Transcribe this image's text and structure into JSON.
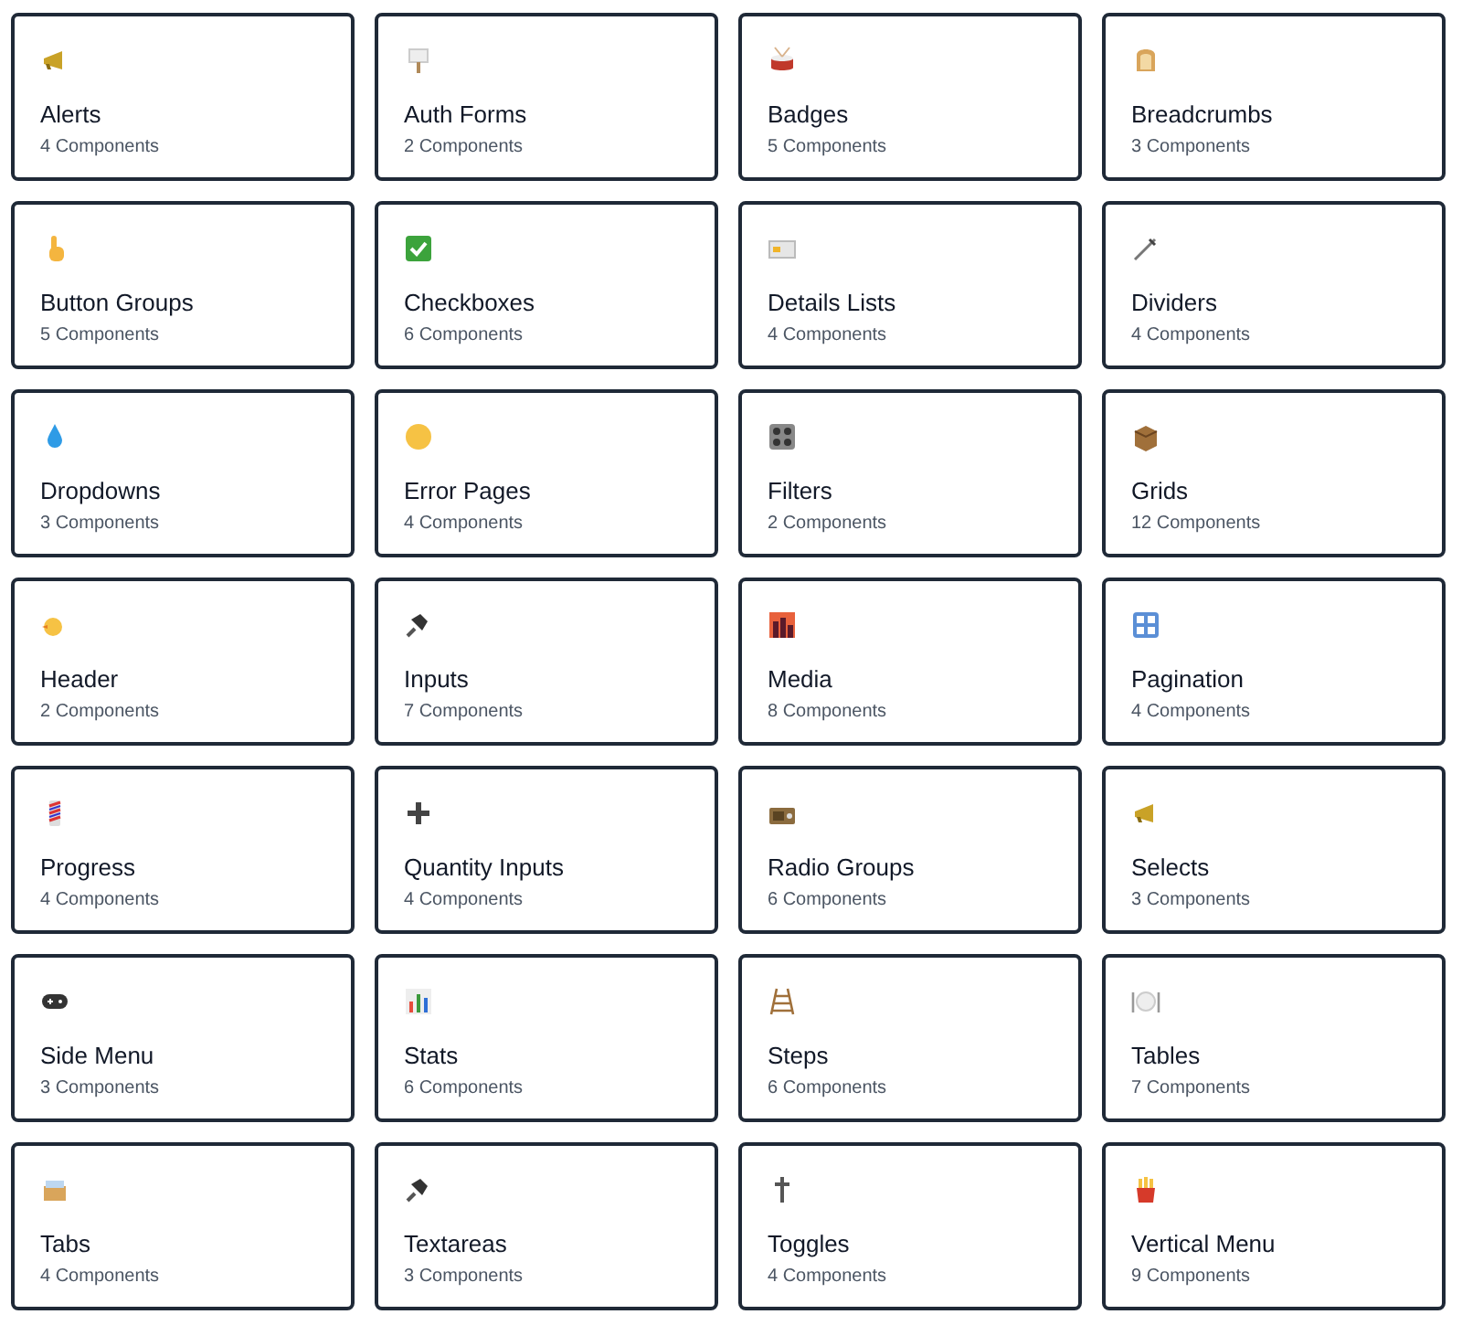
{
  "cards": [
    {
      "title": "Alerts",
      "count": "4 Components"
    },
    {
      "title": "Auth Forms",
      "count": "2 Components"
    },
    {
      "title": "Badges",
      "count": "5 Components"
    },
    {
      "title": "Breadcrumbs",
      "count": "3 Components"
    },
    {
      "title": "Button Groups",
      "count": "5 Components"
    },
    {
      "title": "Checkboxes",
      "count": "6 Components"
    },
    {
      "title": "Details Lists",
      "count": "4 Components"
    },
    {
      "title": "Dividers",
      "count": "4 Components"
    },
    {
      "title": "Dropdowns",
      "count": "3 Components"
    },
    {
      "title": "Error Pages",
      "count": "4 Components"
    },
    {
      "title": "Filters",
      "count": "2 Components"
    },
    {
      "title": "Grids",
      "count": "12 Components"
    },
    {
      "title": "Header",
      "count": "2 Components"
    },
    {
      "title": "Inputs",
      "count": "7 Components"
    },
    {
      "title": "Media",
      "count": "8 Components"
    },
    {
      "title": "Pagination",
      "count": "4 Components"
    },
    {
      "title": "Progress",
      "count": "4 Components"
    },
    {
      "title": "Quantity Inputs",
      "count": "4 Components"
    },
    {
      "title": "Radio Groups",
      "count": "6 Components"
    },
    {
      "title": "Selects",
      "count": "3 Components"
    },
    {
      "title": "Side Menu",
      "count": "3 Components"
    },
    {
      "title": "Stats",
      "count": "6 Components"
    },
    {
      "title": "Steps",
      "count": "6 Components"
    },
    {
      "title": "Tables",
      "count": "7 Components"
    },
    {
      "title": "Tabs",
      "count": "4 Components"
    },
    {
      "title": "Textareas",
      "count": "3 Components"
    },
    {
      "title": "Toggles",
      "count": "4 Components"
    },
    {
      "title": "Vertical Menu",
      "count": "9 Components"
    }
  ]
}
